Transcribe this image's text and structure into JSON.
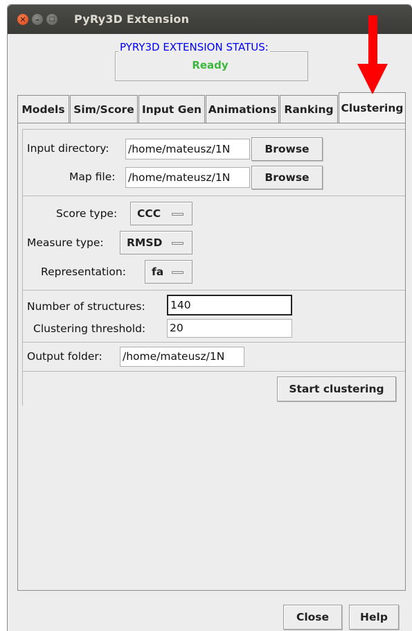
{
  "window": {
    "title": "PyRy3D Extension"
  },
  "status": {
    "title": "PYRY3D EXTENSION STATUS:",
    "value": "Ready",
    "title_color": "#0000ff",
    "value_color": "#3cb63c"
  },
  "tabs": [
    {
      "label": "Models"
    },
    {
      "label": "Sim/Score"
    },
    {
      "label": "Input Gen"
    },
    {
      "label": "Animations"
    },
    {
      "label": "Ranking"
    },
    {
      "label": "Clustering",
      "active": true
    }
  ],
  "inputs": {
    "input_directory": {
      "label": "Input directory:",
      "value": "/home/mateusz/1N",
      "button": "Browse"
    },
    "map_file": {
      "label": "Map file:",
      "value": "/home/mateusz/1N",
      "button": "Browse"
    }
  },
  "options": {
    "score_type": {
      "label": "Score type:",
      "value": "CCC"
    },
    "measure_type": {
      "label": "Measure type:",
      "value": "RMSD"
    },
    "representation": {
      "label": "Representation:",
      "value": "fa"
    }
  },
  "params": {
    "num_structures": {
      "label": "Number of structures:",
      "value": "140"
    },
    "threshold": {
      "label": "Clustering threshold:",
      "value": "20"
    }
  },
  "output": {
    "label": "Output folder:",
    "value": "/home/mateusz/1N"
  },
  "actions": {
    "start": "Start clustering"
  },
  "footer": {
    "close": "Close",
    "help": "Help"
  },
  "annotation": {
    "arrow_color": "#ff0000",
    "arrow_icon": "red-arrow-down-icon"
  }
}
